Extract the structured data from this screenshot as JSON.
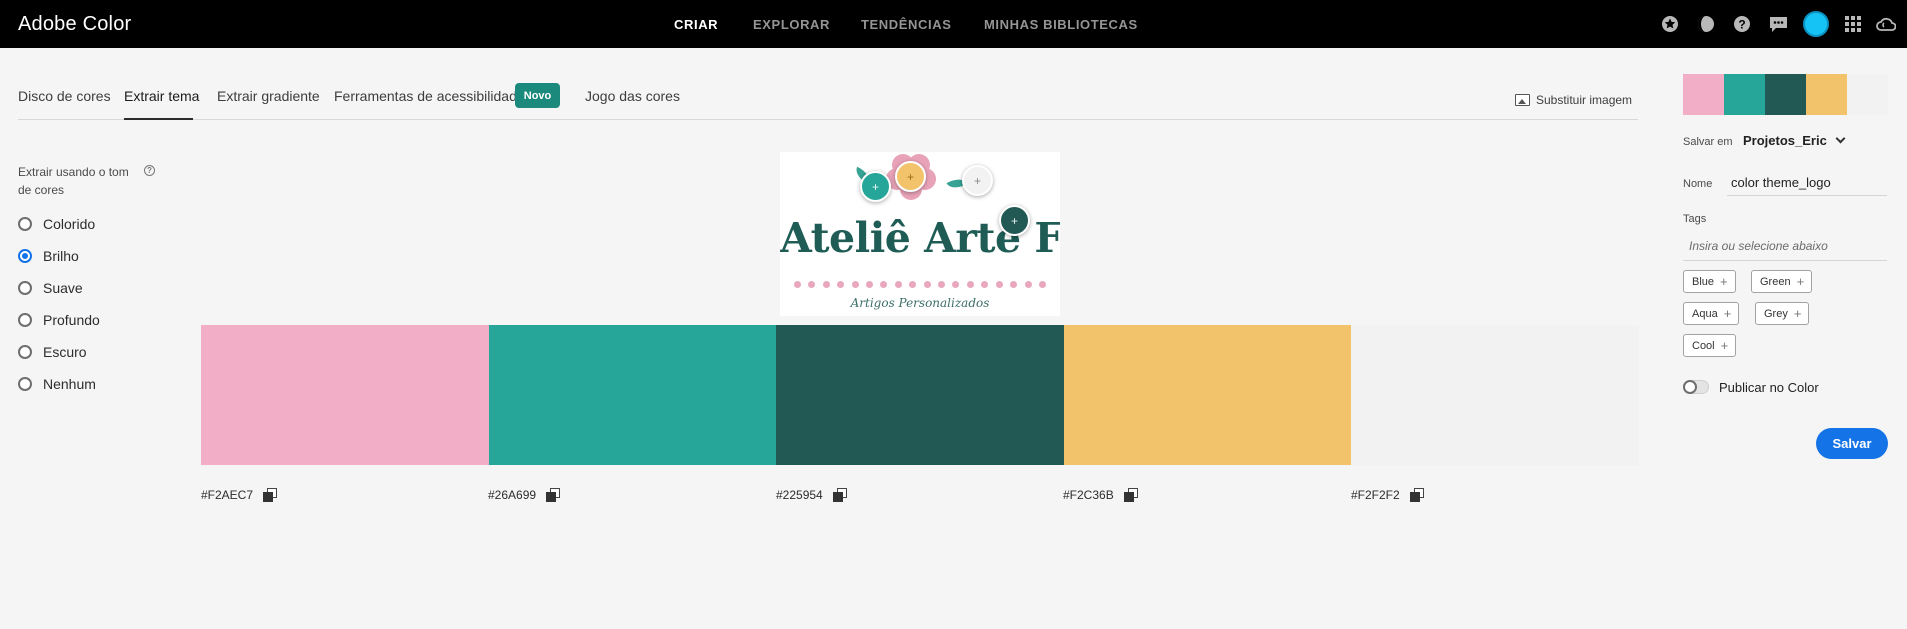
{
  "app": {
    "title": "Adobe Color"
  },
  "topnav": {
    "items": [
      {
        "label": "CRIAR",
        "active": true
      },
      {
        "label": "EXPLORAR",
        "active": false
      },
      {
        "label": "TENDÊNCIAS",
        "active": false
      },
      {
        "label": "MINHAS BIBLIOTECAS",
        "active": false
      }
    ],
    "icons": [
      "star-icon",
      "theme-icon",
      "help-icon",
      "feedback-icon",
      "avatar",
      "apps-grid-icon",
      "creative-cloud-icon"
    ]
  },
  "tabs": {
    "items": [
      {
        "label": "Disco de cores"
      },
      {
        "label": "Extrair tema",
        "active": true
      },
      {
        "label": "Extrair gradiente"
      },
      {
        "label": "Ferramentas de acessibilidade"
      },
      {
        "label": "Jogo das cores"
      }
    ],
    "new_badge": "Novo",
    "replace_image": "Substituir imagem"
  },
  "mood": {
    "title": "Extrair usando o tom de cores",
    "options": [
      {
        "label": "Colorido",
        "checked": false
      },
      {
        "label": "Brilho",
        "checked": true
      },
      {
        "label": "Suave",
        "checked": false
      },
      {
        "label": "Profundo",
        "checked": false
      },
      {
        "label": "Escuro",
        "checked": false
      },
      {
        "label": "Nenhum",
        "checked": false
      }
    ]
  },
  "image": {
    "title": "Ateliê Arte Fina",
    "subtitle": "Artigos Personalizados"
  },
  "swatches": [
    {
      "hex": "#F2AEC7",
      "color": "#F2AEC7"
    },
    {
      "hex": "#26A699",
      "color": "#26A699"
    },
    {
      "hex": "#225954",
      "color": "#225954"
    },
    {
      "hex": "#F2C36B",
      "color": "#F2C36B"
    },
    {
      "hex": "#F2F2F2",
      "color": "#F2F2F2"
    }
  ],
  "panel": {
    "save_in_label": "Salvar em",
    "save_in_value": "Projetos_Eric",
    "name_label": "Nome",
    "name_value": "color theme_logo",
    "tags_label": "Tags",
    "tags_placeholder": "Insira ou selecione abaixo",
    "tags": [
      "Blue",
      "Green",
      "Aqua",
      "Grey",
      "Cool"
    ],
    "publish_label": "Publicar no Color",
    "publish_on": false,
    "save_button": "Salvar"
  },
  "colors": {
    "accent": "#1473E6",
    "badge": "#1B8A7D",
    "topbar": "#000000"
  }
}
